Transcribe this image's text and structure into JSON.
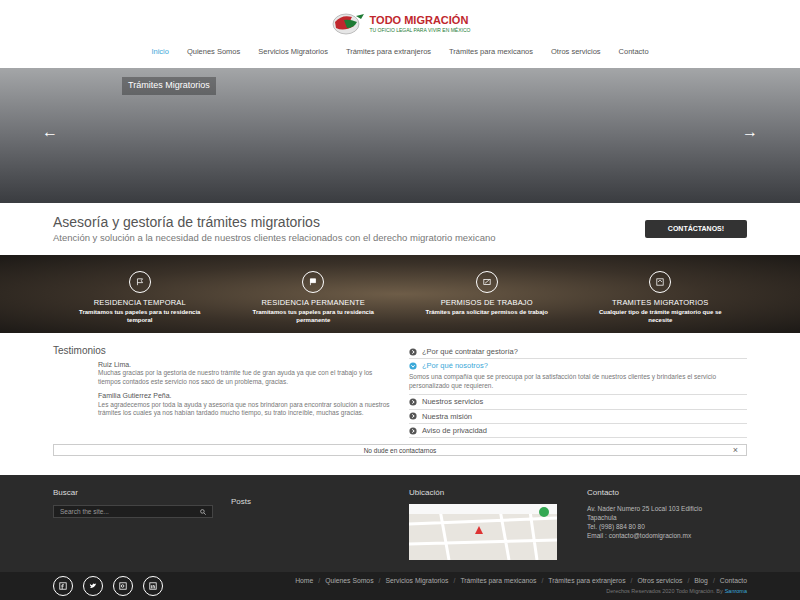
{
  "logo": {
    "title": "TODO MIGRACIÓN",
    "tagline": "TU OFICIO LEGAL PARA VIVIR EN MÉXICO"
  },
  "nav": [
    {
      "label": "Inicio",
      "selected": true
    },
    {
      "label": "Quienes Somos",
      "selected": false
    },
    {
      "label": "Servicios Migratorios",
      "selected": false
    },
    {
      "label": "Trámites para extranjeros",
      "selected": false
    },
    {
      "label": "Trámites para mexicanos",
      "selected": false
    },
    {
      "label": "Otros servicios",
      "selected": false
    },
    {
      "label": "Contacto",
      "selected": false
    }
  ],
  "hero": {
    "caption": "Trámites Migratorios",
    "prev": "←",
    "next": "→"
  },
  "intro": {
    "title": "Asesoría y gestoría de trámites migratorios",
    "subtitle": "Atención y solución a la necesidad de nuestros clientes relacionados con el derecho migratorio mexicano",
    "button": "CONTÁCTANOS!"
  },
  "features": [
    {
      "title": "RESIDENCIA TEMPORAL",
      "text": "Tramitamos tus papeles para tu residencia temporal"
    },
    {
      "title": "RESIDENCIA PERMANENTE",
      "text": "Tramitamos tus papeles para tu residencia permanente"
    },
    {
      "title": "PERMISOS DE TRABAJO",
      "text": "Trámites para solicitar permisos de trabajo"
    },
    {
      "title": "TRAMITES MIGRATORIOS",
      "text": "Cualquier tipo de trámite migratorio que se necesite"
    }
  ],
  "testimonials": {
    "title": "Testimonios",
    "items": [
      {
        "name": "Ruiz Lima.",
        "text": "Muchas gracias por la gestoria de nuestro trámite fue de gran ayuda ya que con el trabajo y los tiempos contados este servicio nos sacó de un problema, gracias."
      },
      {
        "name": "Familia Gutierrez Peña.",
        "text": "Les agradecemos por toda la ayuda y asesoría que nos brindaron para encontrar solución a nuestros trámites los cuales ya nos habían tardado mucho tiempo, su trato increíble, muchas gracias."
      }
    ]
  },
  "accordion": [
    {
      "label": "¿Por qué contratar gestoría?",
      "expanded": false,
      "body": ""
    },
    {
      "label": "¿Por qué nosotros?",
      "expanded": true,
      "body": "Somos una compañía que se preocupa por la satisfacción total de nuestros clientes y brindarles el servicio personalizado que requieren."
    },
    {
      "label": "Nuestros servicios",
      "expanded": false,
      "body": ""
    },
    {
      "label": "Nuestra misión",
      "expanded": false,
      "body": ""
    },
    {
      "label": "Aviso de privacidad",
      "expanded": false,
      "body": ""
    }
  ],
  "contact_bar": {
    "text": "No dude en contactarnos",
    "close": "×"
  },
  "footer": {
    "search": {
      "title": "Buscar",
      "placeholder": "Search the site..."
    },
    "posts": {
      "title": "Posts"
    },
    "location": {
      "title": "Ubicación"
    },
    "contact": {
      "title": "Contacto",
      "lines": [
        "Av. Nader Numero 25 Local 103 Edificio",
        "Tapachula",
        "Tel. (998) 884 80 80",
        "Email : contacto@todomigracion.mx"
      ]
    }
  },
  "bottom": {
    "separator": "/",
    "links": [
      "Home",
      "Quienes Somos",
      "Servicios Migratorios",
      "Trámites para mexicanos",
      "Trámites para extranjeros",
      "Otros servicios",
      "Blog",
      "Contacto"
    ],
    "copyright": "Derechos Reservados 2020 Todo Migración. By",
    "author": "Sanroma"
  }
}
